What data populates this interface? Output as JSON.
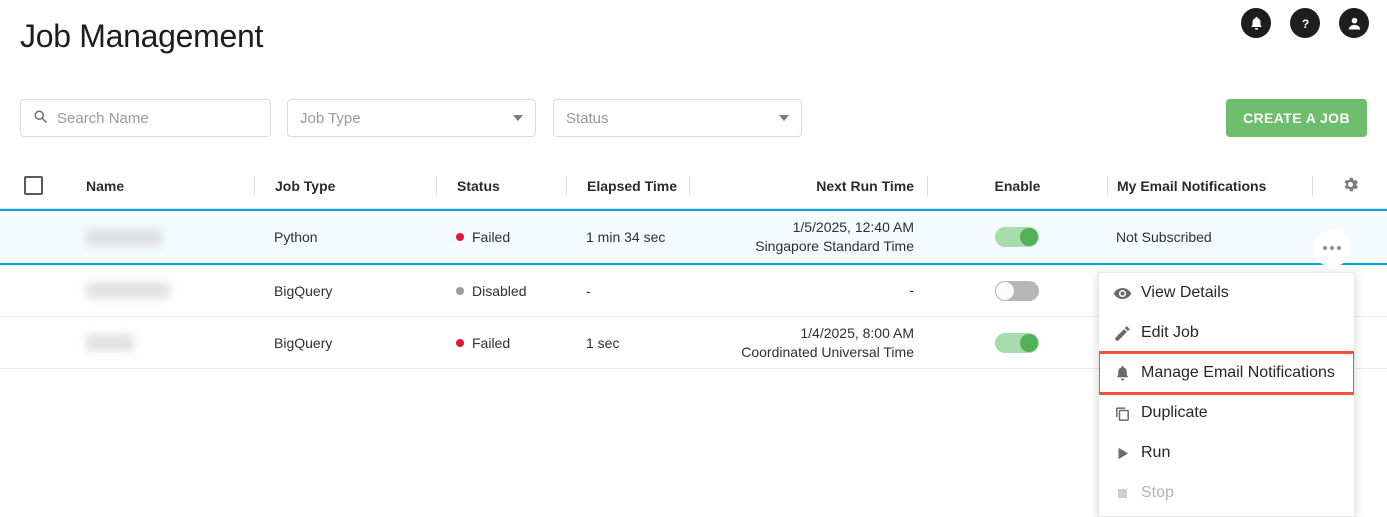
{
  "header": {
    "title": "Job Management",
    "icons": [
      {
        "name": "notifications-bell-icon",
        "glyph": "bell"
      },
      {
        "name": "help-icon",
        "glyph": "question"
      },
      {
        "name": "account-icon",
        "glyph": "person"
      }
    ]
  },
  "filters": {
    "search_placeholder": "Search Name",
    "search_value": "",
    "job_type_label": "Job Type",
    "status_label": "Status",
    "create_button": "CREATE A JOB"
  },
  "table": {
    "columns": {
      "name": "Name",
      "job_type": "Job Type",
      "status": "Status",
      "elapsed_time": "Elapsed Time",
      "next_run_time": "Next Run Time",
      "enable": "Enable",
      "my_email_notifications": "My Email Notifications"
    },
    "rows": [
      {
        "name": "",
        "job_type": "Python",
        "status": "Failed",
        "status_kind": "failed",
        "elapsed_time": "1 min 34 sec",
        "next_run_time_date": "1/5/2025, 12:40 AM",
        "next_run_time_zone": "Singapore Standard Time",
        "enabled": true,
        "email_notifications": "Not Subscribed",
        "selected": true
      },
      {
        "name": "",
        "job_type": "BigQuery",
        "status": "Disabled",
        "status_kind": "disabled",
        "elapsed_time": "-",
        "next_run_time_date": "-",
        "next_run_time_zone": "",
        "enabled": false,
        "email_notifications": "",
        "selected": false
      },
      {
        "name": "",
        "job_type": "BigQuery",
        "status": "Failed",
        "status_kind": "failed",
        "elapsed_time": "1 sec",
        "next_run_time_date": "1/4/2025, 8:00 AM",
        "next_run_time_zone": "Coordinated Universal Time",
        "enabled": true,
        "email_notifications": "",
        "selected": false
      }
    ]
  },
  "context_menu": {
    "items": [
      {
        "label": "View Details",
        "icon": "eye-icon",
        "disabled": false,
        "highlighted": false
      },
      {
        "label": "Edit Job",
        "icon": "pencil-icon",
        "disabled": false,
        "highlighted": false
      },
      {
        "label": "Manage Email Notifications",
        "icon": "bell-icon",
        "disabled": false,
        "highlighted": true
      },
      {
        "label": "Duplicate",
        "icon": "copy-icon",
        "disabled": false,
        "highlighted": false
      },
      {
        "label": "Run",
        "icon": "play-icon",
        "disabled": false,
        "highlighted": false
      },
      {
        "label": "Stop",
        "icon": "stop-square-icon",
        "disabled": true,
        "highlighted": false
      }
    ]
  },
  "colors": {
    "accent_green": "#6cbe6c",
    "selected_row_border": "#00a5dc",
    "highlight_box": "#f4523b",
    "status_failed": "#e2173c",
    "status_disabled": "#9b9b9b"
  }
}
